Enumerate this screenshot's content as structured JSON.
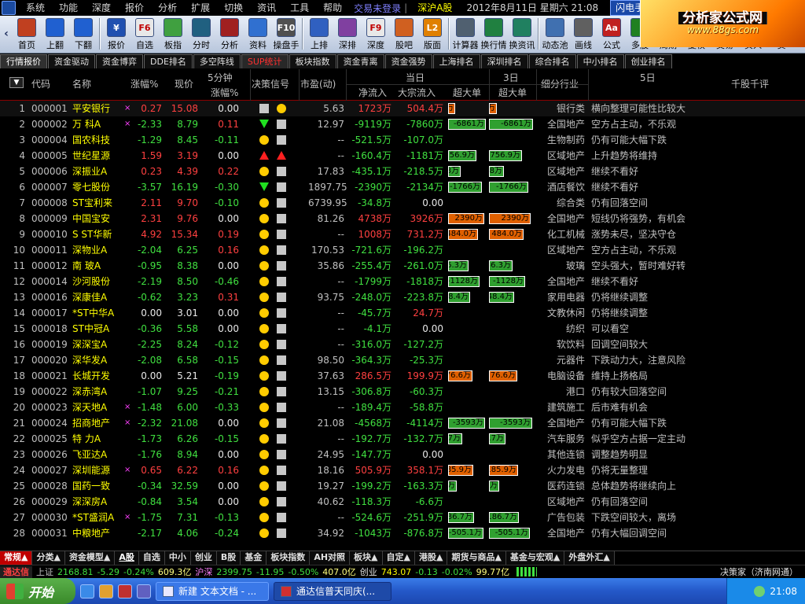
{
  "menubar": {
    "items": [
      "系统",
      "功能",
      "深度",
      "报价",
      "分析",
      "扩展",
      "切换",
      "资讯",
      "工具",
      "帮助"
    ],
    "trade_status": "交易未登录",
    "market": "深沪A股",
    "datetime": "2012年8月11日 星期六 21:08",
    "flash": "闪电手",
    "info": "信息"
  },
  "brand": {
    "title": "分析家公式网",
    "url": "www.88gs.com"
  },
  "toolbar": {
    "group1": [
      {
        "label": "首页",
        "icon": "home-icon",
        "color": "#c04020"
      },
      {
        "label": "上翻",
        "icon": "arrow-up-icon",
        "color": "#2060d0"
      },
      {
        "label": "下翻",
        "icon": "arrow-down-icon",
        "color": "#2060d0"
      }
    ],
    "group2": [
      {
        "label": "报价",
        "icon": "yen-icon",
        "color": "#2050b0",
        "glyph": "¥"
      },
      {
        "label": "自选",
        "icon": "f6-icon",
        "color": "#e8e8e8",
        "glyph": "F6"
      },
      {
        "label": "板指",
        "icon": "pie-icon",
        "color": "#40a040"
      },
      {
        "label": "分时",
        "icon": "line-chart-icon",
        "color": "#206080"
      },
      {
        "label": "分析",
        "icon": "candle-icon",
        "color": "#a02020"
      },
      {
        "label": "资料",
        "icon": "doc-icon",
        "color": "#3070d0"
      },
      {
        "label": "操盘手",
        "icon": "f10-icon",
        "color": "#505050",
        "glyph": "F10"
      }
    ],
    "group3": [
      {
        "label": "上排",
        "icon": "rank-up-icon",
        "color": "#3060c0"
      },
      {
        "label": "深排",
        "icon": "rank-sz-icon",
        "color": "#8040a0"
      },
      {
        "label": "深度",
        "icon": "f9-icon",
        "color": "#e8e8e8",
        "glyph": "F9"
      },
      {
        "label": "股吧",
        "icon": "people-icon",
        "color": "#d06020"
      },
      {
        "label": "版面",
        "icon": "l2-icon",
        "color": "#e08000",
        "glyph": "L2"
      }
    ],
    "group4": [
      {
        "label": "计算器",
        "icon": "calculator-icon",
        "color": "#506070"
      },
      {
        "label": "换行情",
        "icon": "switch-quote-icon",
        "color": "#208040"
      },
      {
        "label": "换资讯",
        "icon": "switch-news-icon",
        "color": "#208060"
      }
    ],
    "group5": [
      {
        "label": "动态池",
        "icon": "pool-icon",
        "color": "#4070b0"
      },
      {
        "label": "画线",
        "icon": "draw-icon",
        "color": "#606060"
      },
      {
        "label": "公式",
        "icon": "formula-icon",
        "color": "#c02020",
        "glyph": "Aa"
      },
      {
        "label": "多股",
        "icon": "multi-stock-icon",
        "color": "#208020"
      },
      {
        "label": "周期",
        "icon": "cycle-icon",
        "color": "#406080"
      },
      {
        "label": "复权",
        "icon": "adjust-icon",
        "color": "#606080"
      },
      {
        "label": "交易",
        "icon": "trade-icon",
        "color": "#b03030"
      },
      {
        "label": "买入",
        "icon": "buy-icon",
        "color": "#c02020"
      },
      {
        "label": "卖",
        "icon": "sell-icon",
        "color": "#20a020"
      }
    ]
  },
  "tabs": [
    "行情报价",
    "资金驱动",
    "资金博弈",
    "DDE排名",
    "多空阵线",
    "SUP统计",
    "板块指数",
    "资金青离",
    "资金强势",
    "上海排名",
    "深圳排名",
    "综合排名",
    "中小排名",
    "创业排名"
  ],
  "active_tab": "SUP统计",
  "headers": {
    "code": "代码",
    "name": "名称",
    "chg": "涨幅%",
    "price": "现价",
    "m5_top": "5分钟",
    "m5_bot": "涨幅%",
    "signal": "决策信号",
    "pe": "市盈(动)",
    "today": "当日",
    "net": "净流入",
    "big": "大宗流入",
    "super1": "超大单",
    "d3": "3日",
    "super3": "超大单",
    "industry": "细分行业",
    "d5": "5日",
    "comment": "千股千评"
  },
  "rows": [
    {
      "i": "1",
      "code": "000001",
      "name": "平安银行",
      "x": "×",
      "chg": "0.27",
      "price": "15.08",
      "m5": "0.00",
      "s1": "sq",
      "s2": "dot",
      "pe": "5.63",
      "net": "1723万",
      "big": "504.4万",
      "sd": "37.0万",
      "sv": 0.18,
      "sd3": "37.0万",
      "sv3": 0.18,
      "ind": "银行类",
      "cmt": "横向整理可能性比较大"
    },
    {
      "i": "2",
      "code": "000002",
      "name": "万  科A",
      "x": "×",
      "chg": "-2.33",
      "price": "8.79",
      "m5": "0.11",
      "s1": "tri-dn",
      "s2": "sq",
      "pe": "12.97",
      "net": "-9119万",
      "big": "-7860万",
      "sd": "-6861万",
      "sv": 0.96,
      "sd3": "-6861万",
      "sv3": 0.96,
      "ind": "全国地产",
      "cmt": "空方占主动，不乐观"
    },
    {
      "i": "3",
      "code": "000004",
      "name": "国农科技",
      "x": "",
      "chg": "-1.29",
      "price": "8.45",
      "m5": "-0.11",
      "s1": "dot",
      "s2": "sq",
      "pe": "--",
      "net": "-521.5万",
      "big": "-107.0万",
      "sd": "",
      "sv": 0,
      "sd3": "",
      "sv3": 0,
      "ind": "生物制药",
      "cmt": "仍有可能大幅下跌"
    },
    {
      "i": "4",
      "code": "000005",
      "name": "世纪星源",
      "x": "",
      "chg": "1.59",
      "price": "3.19",
      "m5": "0.00",
      "s1": "tri-up",
      "s2": "tri-up",
      "pe": "--",
      "net": "-160.4万",
      "big": "-1181万",
      "sd": "-756.9万",
      "sv": 0.72,
      "sd3": "-756.9万",
      "sv3": 0.72,
      "ind": "区域地产",
      "cmt": "上升趋势将维持"
    },
    {
      "i": "5",
      "code": "000006",
      "name": "深振业A",
      "x": "",
      "chg": "0.23",
      "price": "4.39",
      "m5": "0.22",
      "s1": "dot",
      "s2": "sq",
      "pe": "17.83",
      "net": "-435.1万",
      "big": "-218.5万",
      "sd": "-92.8万",
      "sv": 0.32,
      "sd3": "-92.8万",
      "sv3": 0.32,
      "ind": "区域地产",
      "cmt": "继续不看好"
    },
    {
      "i": "6",
      "code": "000007",
      "name": "零七股份",
      "x": "",
      "chg": "-3.57",
      "price": "16.19",
      "m5": "-0.30",
      "s1": "tri-dn",
      "s2": "sq",
      "pe": "1897.75",
      "net": "-2390万",
      "big": "-2134万",
      "sd": "-1766万",
      "sv": 0.86,
      "sd3": "-1766万",
      "sv3": 0.86,
      "ind": "酒店餐饮",
      "cmt": "继续不看好"
    },
    {
      "i": "7",
      "code": "000008",
      "name": "ST宝利来",
      "x": "",
      "chg": "2.11",
      "price": "9.70",
      "m5": "-0.10",
      "s1": "dot",
      "s2": "sq",
      "pe": "6739.95",
      "net": "-34.8万",
      "big": "0.00",
      "sd": "",
      "sv": 0,
      "sd3": "",
      "sv3": 0,
      "ind": "综合类",
      "cmt": "仍有回落空间"
    },
    {
      "i": "8",
      "code": "000009",
      "name": "中国宝安",
      "x": "",
      "chg": "2.31",
      "price": "9.76",
      "m5": "0.00",
      "s1": "dot",
      "s2": "sq",
      "pe": "81.26",
      "net": "4738万",
      "big": "3926万",
      "sd": "2390万",
      "sv": 0.92,
      "sd3": "2390万",
      "sv3": 0.92,
      "ind": "全国地产",
      "cmt": "短线仍将强势，有机会"
    },
    {
      "i": "9",
      "code": "000010",
      "name": "S ST华新",
      "x": "",
      "chg": "4.92",
      "price": "15.34",
      "m5": "0.19",
      "s1": "dot",
      "s2": "sq",
      "pe": "--",
      "net": "1008万",
      "big": "731.2万",
      "sd": "484.0万",
      "sv": 0.76,
      "sd3": "484.0万",
      "sv3": 0.76,
      "ind": "化工机械",
      "cmt": "涨势未尽，坚决守仓"
    },
    {
      "i": "10",
      "code": "000011",
      "name": "深物业A",
      "x": "",
      "chg": "-2.04",
      "price": "6.25",
      "m5": "0.16",
      "s1": "dot",
      "s2": "sq",
      "pe": "170.53",
      "net": "-721.6万",
      "big": "-196.2万",
      "sd": "",
      "sv": 0,
      "sd3": "",
      "sv3": 0,
      "ind": "区域地产",
      "cmt": "空方占主动，不乐观"
    },
    {
      "i": "11",
      "code": "000012",
      "name": "南  玻A",
      "x": "",
      "chg": "-0.95",
      "price": "8.38",
      "m5": "0.00",
      "s1": "dot",
      "s2": "sq",
      "pe": "35.86",
      "net": "-255.4万",
      "big": "-261.0万",
      "sd": "-136.3万",
      "sv": 0.52,
      "sd3": "-136.3万",
      "sv3": 0.52,
      "ind": "玻璃",
      "cmt": "空头强大，暂时难好转"
    },
    {
      "i": "12",
      "code": "000014",
      "name": "沙河股份",
      "x": "",
      "chg": "-2.19",
      "price": "8.50",
      "m5": "-0.46",
      "s1": "dot",
      "s2": "sq",
      "pe": "--",
      "net": "-1799万",
      "big": "-1818万",
      "sd": "-1128万",
      "sv": 0.8,
      "sd3": "-1128万",
      "sv3": 0.8,
      "ind": "全国地产",
      "cmt": "继续不看好"
    },
    {
      "i": "13",
      "code": "000016",
      "name": "深康佳A",
      "x": "",
      "chg": "-0.62",
      "price": "3.23",
      "m5": "0.31",
      "s1": "dot",
      "s2": "sq",
      "pe": "93.75",
      "net": "-248.0万",
      "big": "-223.8万",
      "sd": "-148.4万",
      "sv": 0.56,
      "sd3": "-148.4万",
      "sv3": 0.56,
      "ind": "家用电器",
      "cmt": "仍将继续调整"
    },
    {
      "i": "14",
      "code": "000017",
      "name": "*ST中华A",
      "x": "",
      "chg": "0.00",
      "price": "3.01",
      "m5": "0.00",
      "s1": "dot",
      "s2": "sq",
      "pe": "--",
      "net": "-45.7万",
      "big": "24.7万",
      "sd": "",
      "sv": 0,
      "sd3": "",
      "sv3": 0,
      "ind": "文教休闲",
      "cmt": "仍将继续调整"
    },
    {
      "i": "15",
      "code": "000018",
      "name": "ST中冠A",
      "x": "",
      "chg": "-0.36",
      "price": "5.58",
      "m5": "0.00",
      "s1": "dot",
      "s2": "sq",
      "pe": "--",
      "net": "-4.1万",
      "big": "0.00",
      "sd": "",
      "sv": 0,
      "sd3": "",
      "sv3": 0,
      "ind": "纺织",
      "cmt": "可以看空"
    },
    {
      "i": "16",
      "code": "000019",
      "name": "深深宝A",
      "x": "",
      "chg": "-2.25",
      "price": "8.24",
      "m5": "-0.12",
      "s1": "dot",
      "s2": "sq",
      "pe": "--",
      "net": "-316.0万",
      "big": "-127.2万",
      "sd": "",
      "sv": 0,
      "sd3": "",
      "sv3": 0,
      "ind": "软饮料",
      "cmt": "回调空间较大"
    },
    {
      "i": "17",
      "code": "000020",
      "name": "深华发A",
      "x": "",
      "chg": "-2.08",
      "price": "6.58",
      "m5": "-0.15",
      "s1": "dot",
      "s2": "sq",
      "pe": "98.50",
      "net": "-364.3万",
      "big": "-25.3万",
      "sd": "",
      "sv": 0,
      "sd3": "",
      "sv3": 0,
      "ind": "元器件",
      "cmt": "下跌动力大，注意风险"
    },
    {
      "i": "18",
      "code": "000021",
      "name": "长城开发",
      "x": "",
      "chg": "0.00",
      "price": "5.21",
      "m5": "-0.19",
      "s1": "dot",
      "s2": "sq",
      "pe": "37.63",
      "net": "286.5万",
      "big": "199.9万",
      "sd": "176.6万",
      "sv": 0.62,
      "sd3": "176.6万",
      "sv3": 0.62,
      "ind": "电脑设备",
      "cmt": "维持上扬格局"
    },
    {
      "i": "19",
      "code": "000022",
      "name": "深赤湾A",
      "x": "",
      "chg": "-1.07",
      "price": "9.25",
      "m5": "-0.21",
      "s1": "dot",
      "s2": "sq",
      "pe": "13.15",
      "net": "-306.8万",
      "big": "-60.3万",
      "sd": "",
      "sv": 0,
      "sd3": "",
      "sv3": 0,
      "ind": "港口",
      "cmt": "仍有较大回落空间"
    },
    {
      "i": "20",
      "code": "000023",
      "name": "深天地A",
      "x": "×",
      "chg": "-1.48",
      "price": "6.00",
      "m5": "-0.33",
      "s1": "dot",
      "s2": "sq",
      "pe": "--",
      "net": "-189.4万",
      "big": "-58.8万",
      "sd": "",
      "sv": 0,
      "sd3": "",
      "sv3": 0,
      "ind": "建筑施工",
      "cmt": "后市难有机会"
    },
    {
      "i": "21",
      "code": "000024",
      "name": "招商地产",
      "x": "×",
      "chg": "-2.32",
      "price": "21.08",
      "m5": "0.00",
      "s1": "dot",
      "s2": "sq",
      "pe": "21.08",
      "net": "-4568万",
      "big": "-4114万",
      "sd": "-3593万",
      "sv": 0.94,
      "sd3": "-3593万",
      "sv3": 0.94,
      "ind": "全国地产",
      "cmt": "仍有可能大幅下跌"
    },
    {
      "i": "22",
      "code": "000025",
      "name": "特  力A",
      "x": "",
      "chg": "-1.73",
      "price": "6.26",
      "m5": "-0.15",
      "s1": "dot",
      "s2": "sq",
      "pe": "--",
      "net": "-192.7万",
      "big": "-132.7万",
      "sd": "-60.7万",
      "sv": 0.36,
      "sd3": "-60.7万",
      "sv3": 0.36,
      "ind": "汽车服务",
      "cmt": "似乎空方占据一定主动"
    },
    {
      "i": "23",
      "code": "000026",
      "name": "飞亚达A",
      "x": "",
      "chg": "-1.76",
      "price": "8.94",
      "m5": "0.00",
      "s1": "dot",
      "s2": "sq",
      "pe": "24.95",
      "net": "-147.7万",
      "big": "0.00",
      "sd": "",
      "sv": 0,
      "sd3": "",
      "sv3": 0,
      "ind": "其他连锁",
      "cmt": "调整趋势明显"
    },
    {
      "i": "24",
      "code": "000027",
      "name": "深圳能源",
      "x": "×",
      "chg": "0.65",
      "price": "6.22",
      "m5": "0.16",
      "s1": "dot",
      "s2": "sq",
      "pe": "18.16",
      "net": "505.9万",
      "big": "358.1万",
      "sd": "185.9万",
      "sv": 0.64,
      "sd3": "185.9万",
      "sv3": 0.64,
      "ind": "火力发电",
      "cmt": "仍将无量整理"
    },
    {
      "i": "25",
      "code": "000028",
      "name": "国药一致",
      "x": "",
      "chg": "-0.34",
      "price": "32.59",
      "m5": "0.00",
      "s1": "dot",
      "s2": "sq",
      "pe": "19.27",
      "net": "-199.2万",
      "big": "-163.3万",
      "sd": "-12.6万",
      "sv": 0.22,
      "sd3": "-12.6万",
      "sv3": 0.22,
      "ind": "医药连锁",
      "cmt": "总体趋势将继续向上"
    },
    {
      "i": "26",
      "code": "000029",
      "name": "深深房A",
      "x": "",
      "chg": "-0.84",
      "price": "3.54",
      "m5": "0.00",
      "s1": "dot",
      "s2": "sq",
      "pe": "40.62",
      "net": "-118.3万",
      "big": "-6.6万",
      "sd": "",
      "sv": 0,
      "sd3": "",
      "sv3": 0,
      "ind": "区域地产",
      "cmt": "仍有回落空间"
    },
    {
      "i": "27",
      "code": "000030",
      "name": "*ST盛润A",
      "x": "×",
      "chg": "-1.75",
      "price": "7.31",
      "m5": "-0.13",
      "s1": "dot",
      "s2": "sq",
      "pe": "--",
      "net": "-524.6万",
      "big": "-251.9万",
      "sd": "-186.7万",
      "sv": 0.66,
      "sd3": "-186.7万",
      "sv3": 0.66,
      "ind": "广告包装",
      "cmt": "下跌空间较大，离场"
    },
    {
      "i": "28",
      "code": "000031",
      "name": "中粮地产",
      "x": "",
      "chg": "-2.17",
      "price": "4.06",
      "m5": "-0.24",
      "s1": "dot",
      "s2": "sq",
      "pe": "34.92",
      "net": "-1043万",
      "big": "-876.8万",
      "sd": "-505.1万",
      "sv": 0.9,
      "sd3": "-505.1万",
      "sv3": 0.9,
      "ind": "全国地产",
      "cmt": "仍有大幅回调空间"
    }
  ],
  "bottom_tabs": [
    "常规▲",
    "分类▲",
    "资金模型▲",
    "A股",
    "自选",
    "中小",
    "创业",
    "B股",
    "基金",
    "板块指数",
    "AH对照",
    "板块▲",
    "自定▲",
    "港股▲",
    "期货与商品▲",
    "基金与宏观▲",
    "外盘外汇▲"
  ],
  "active_bottom_tab": "常规▲",
  "index_bar": {
    "brand": "通达信",
    "sh_label": "上证",
    "sh_val": "2168.81",
    "sh_chg": "-5.29",
    "sh_pct": "-0.24%",
    "sh_amt": "609.3亿",
    "sz_label": "沪深",
    "sz_val": "2399.75",
    "sz_chg": "-11.95",
    "sz_pct": "-0.50%",
    "sz_amt": "407.0亿",
    "cy_label": "创业",
    "cy_val": "743.07",
    "cy_chg": "-0.13",
    "cy_pct": "-0.02%",
    "cy_amt": "99.77亿",
    "server": "决策家（济南网通）"
  },
  "taskbar": {
    "start": "开始",
    "tasks": [
      "新建 文本文档 - ...",
      "通达信普天同庆(..."
    ],
    "clock": "21:08"
  },
  "colors": {
    "up": "#ff4040",
    "down": "#40e040",
    "name": "#ffff00",
    "bar_pos": "#e06000",
    "bar_neg": "#30a030"
  }
}
